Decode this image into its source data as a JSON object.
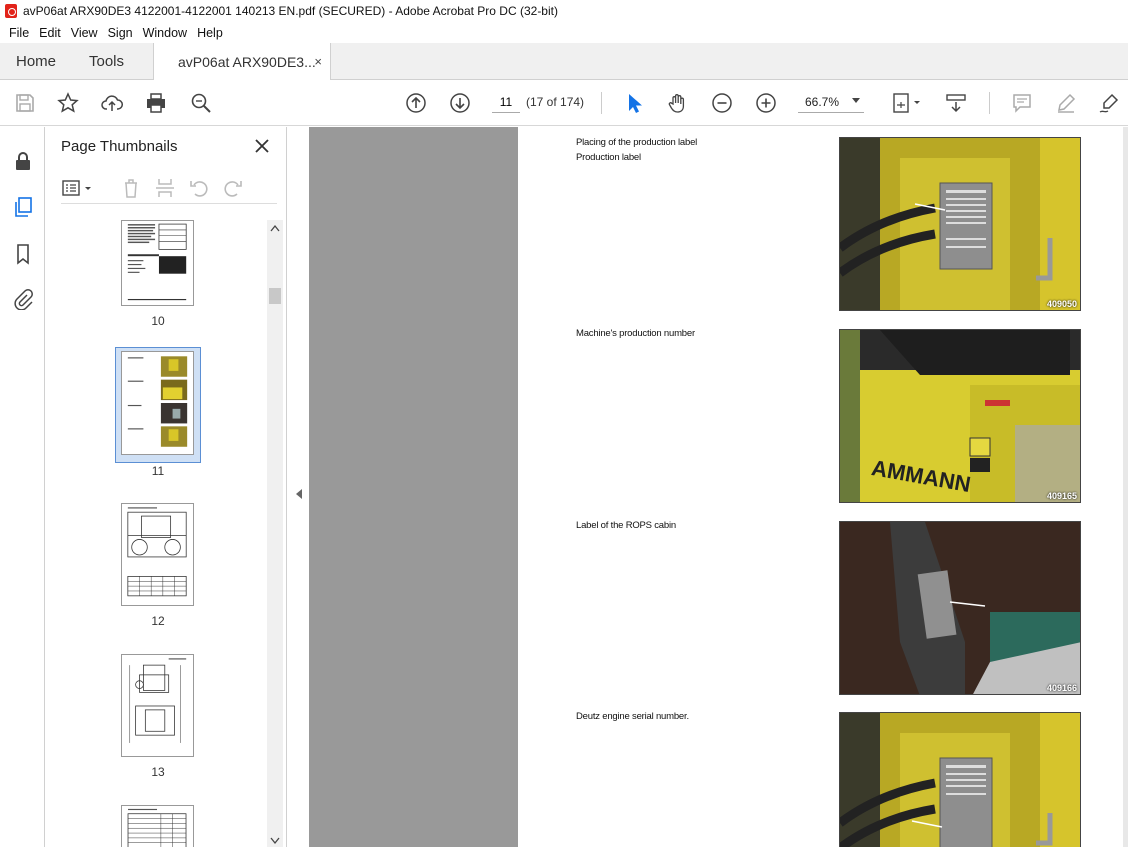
{
  "window": {
    "title": "avP06at ARX90DE3 4122001-4122001 140213 EN.pdf (SECURED) - Adobe Acrobat Pro DC (32-bit)"
  },
  "menu": [
    "File",
    "Edit",
    "View",
    "Sign",
    "Window",
    "Help"
  ],
  "tabs": {
    "home": "Home",
    "tools": "Tools",
    "doc": "avP06at ARX90DE3...",
    "close": "×"
  },
  "toolbar": {
    "page_value": "11",
    "page_count": "(17 of 174)",
    "zoom": "66.7%"
  },
  "panel": {
    "title": "Page Thumbnails",
    "thumbs": [
      {
        "label": "10"
      },
      {
        "label": "11"
      },
      {
        "label": "12"
      },
      {
        "label": "13"
      }
    ]
  },
  "document": {
    "captions": [
      "Placing of the production label",
      "Production label",
      "Machine's production number",
      "Label of the ROPS cabin",
      "Deutz engine serial number."
    ],
    "photos": [
      {
        "num": "409050"
      },
      {
        "num": "409165"
      },
      {
        "num": "409166"
      },
      {
        "num": ""
      }
    ]
  },
  "colors": {
    "accent": "#1473e6",
    "brand": "#e2231a"
  }
}
